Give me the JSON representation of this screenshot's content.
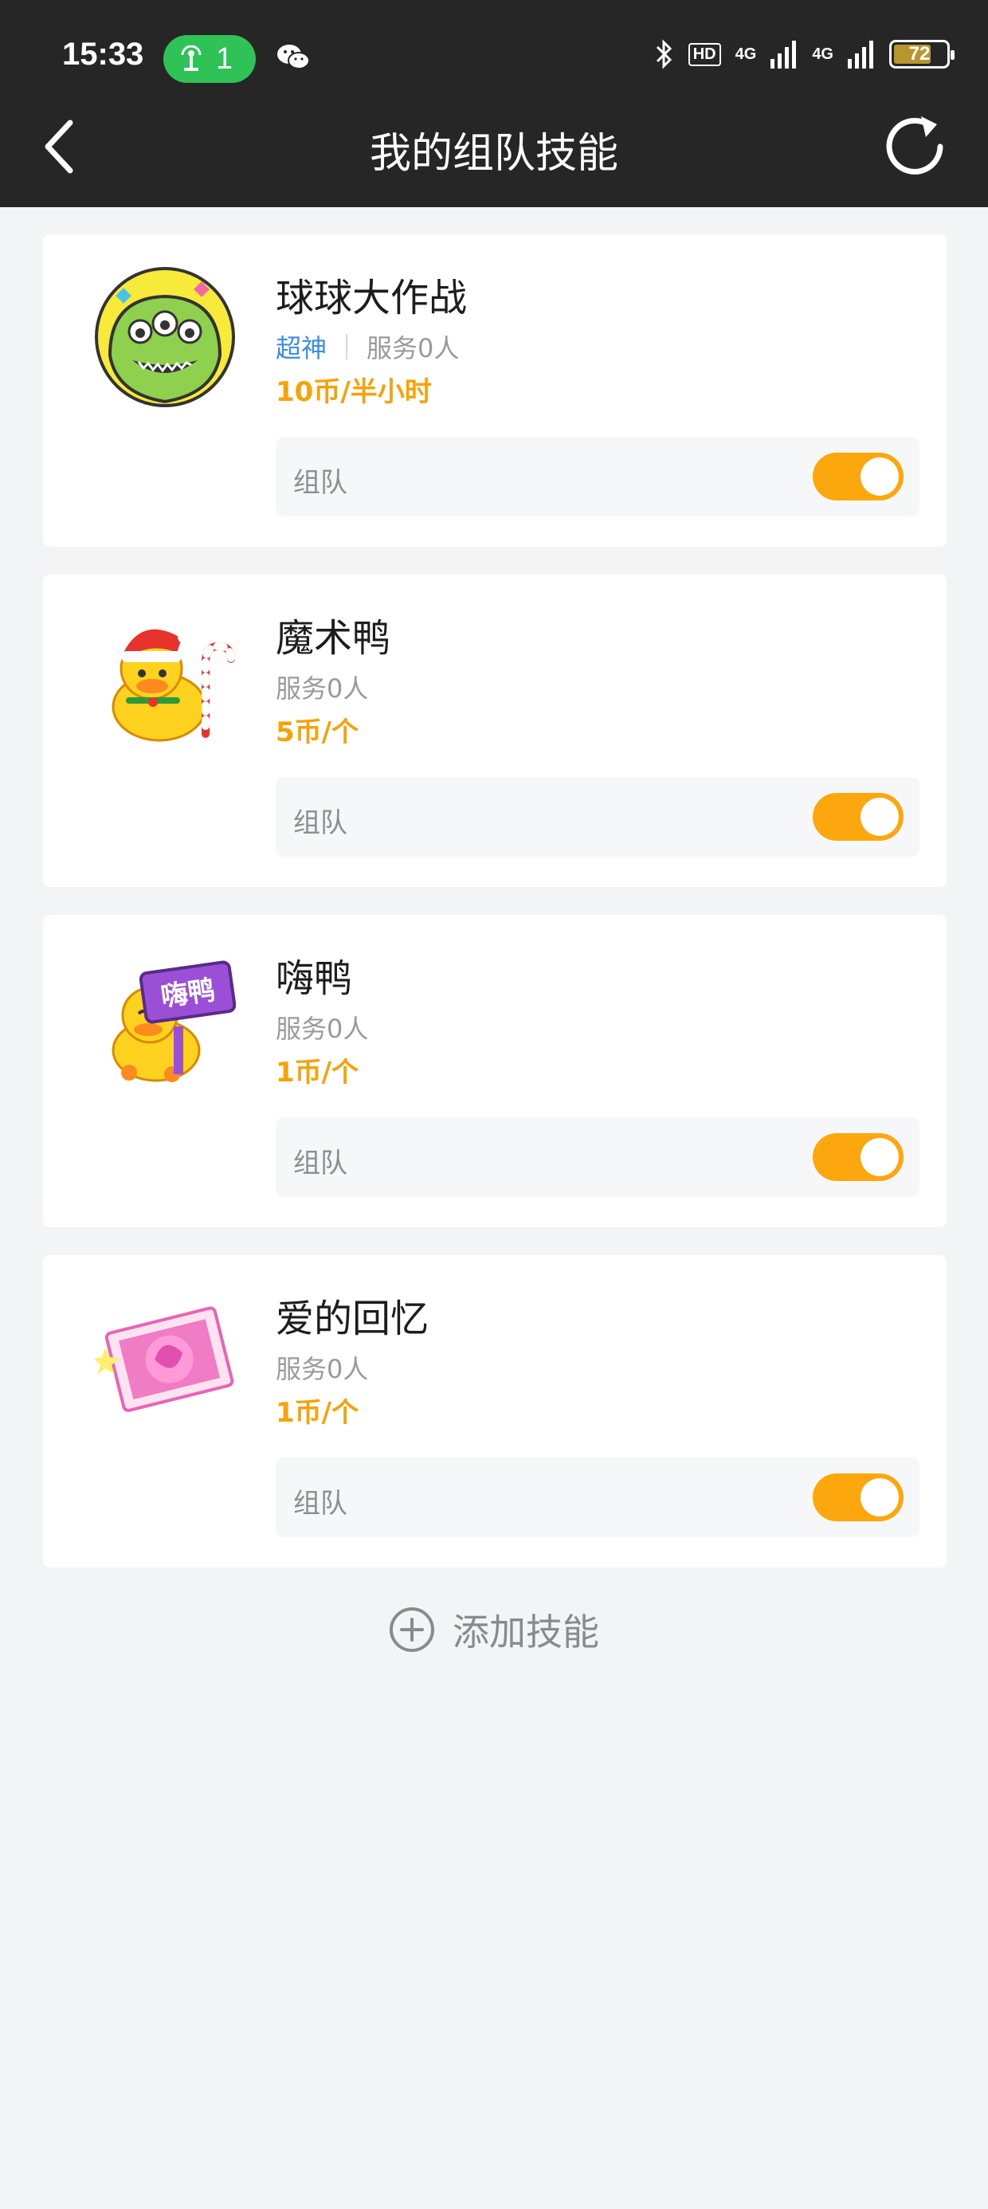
{
  "status_bar": {
    "time": "15:33",
    "hotspot_count": "1",
    "hd_label": "HD",
    "network_label_1": "4G",
    "network_label_2": "4G",
    "battery_level": "72",
    "battery_fraction": 0.72
  },
  "header": {
    "title": "我的组队技能"
  },
  "skills": [
    {
      "name": "球球大作战",
      "rank": "超神",
      "served": "服务0人",
      "price": "10币/半小时",
      "team_label": "组队",
      "team_enabled": true,
      "avatar_icon": "monster-avatar-icon"
    },
    {
      "name": "魔术鸭",
      "rank": "",
      "served": "服务0人",
      "price": "5币/个",
      "team_label": "组队",
      "team_enabled": true,
      "avatar_icon": "christmas-duck-icon"
    },
    {
      "name": "嗨鸭",
      "rank": "",
      "served": "服务0人",
      "price": "1币/个",
      "team_label": "组队",
      "team_enabled": true,
      "avatar_icon": "hi-duck-sign-icon",
      "avatar_sign_text": "嗨鸭"
    },
    {
      "name": "爱的回忆",
      "rank": "",
      "served": "服务0人",
      "price": "1币/个",
      "team_label": "组队",
      "team_enabled": true,
      "avatar_icon": "love-memory-card-icon"
    }
  ],
  "add_skill": {
    "label": "添加技能"
  },
  "colors": {
    "header_bg": "#262626",
    "accent_orange": "#fda70f",
    "price_orange": "#f5a30b",
    "rank_blue": "#3b8fe0",
    "hotspot_green": "#2fc257",
    "page_bg": "#f3f4f6"
  }
}
